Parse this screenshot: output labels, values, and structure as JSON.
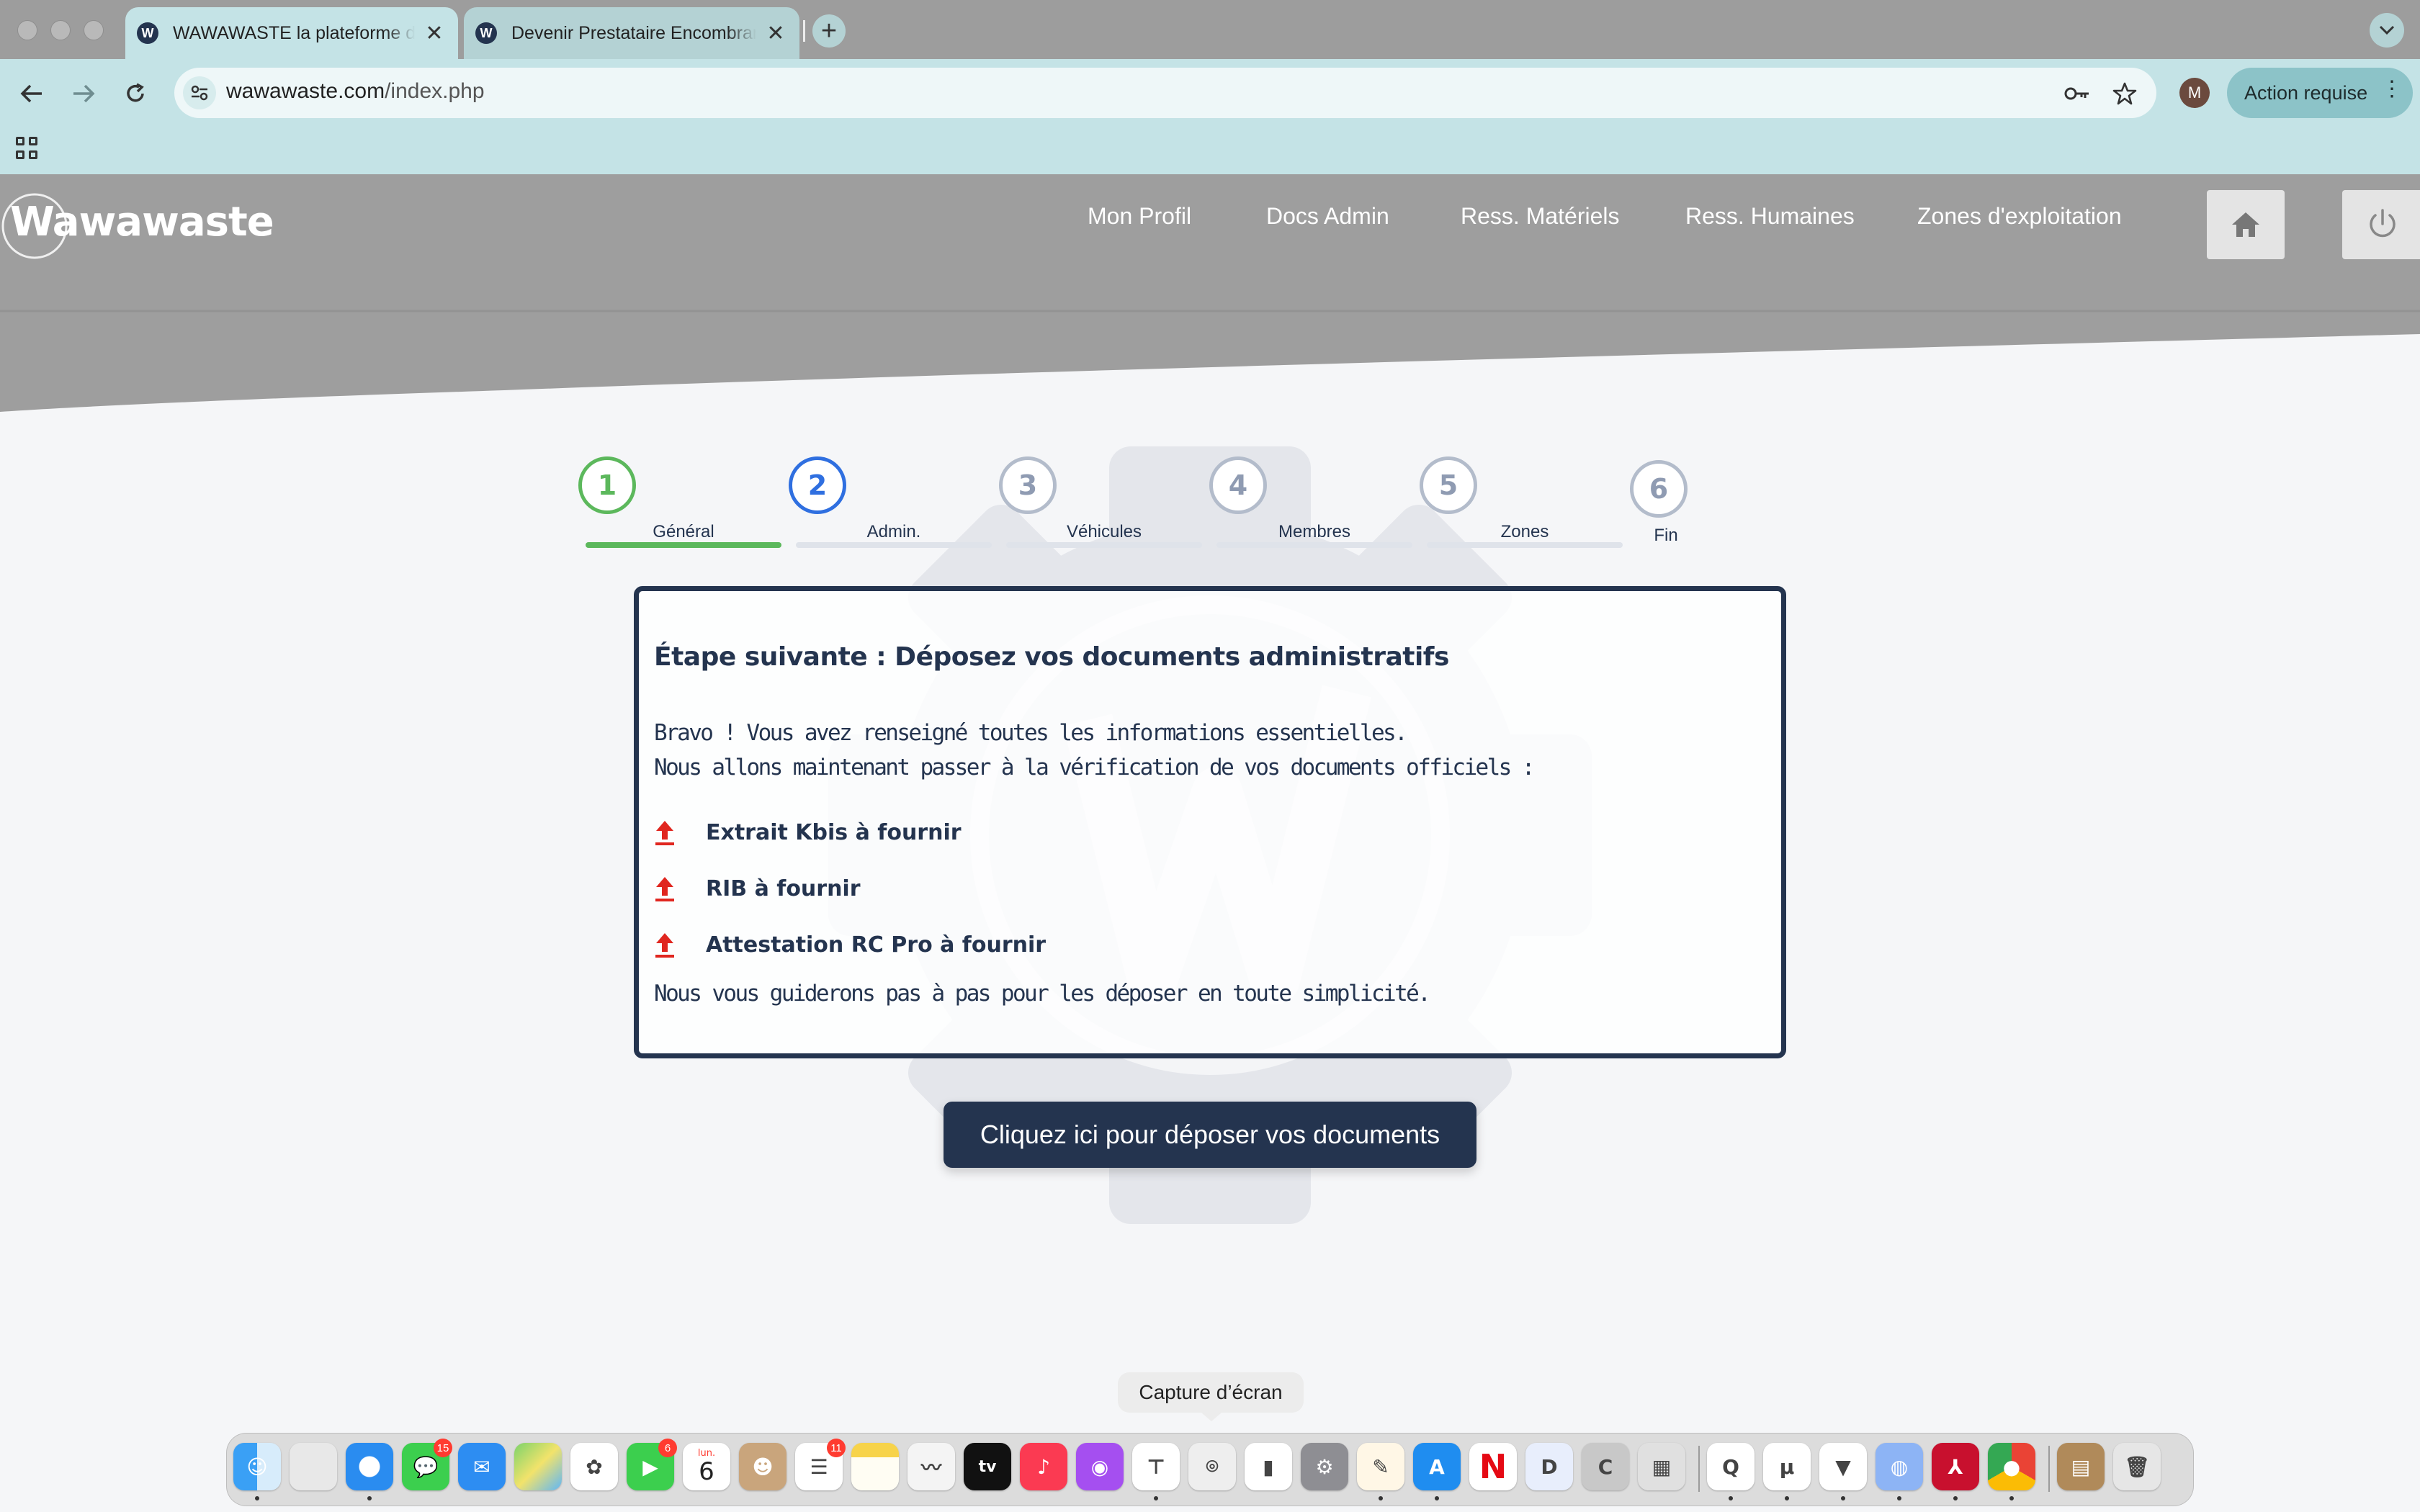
{
  "browser": {
    "tabs": [
      {
        "title": "WAWAWASTE la plateforme des encombrants",
        "active": true
      },
      {
        "title": "Devenir Prestataire Encombrants",
        "active": false
      }
    ],
    "url_domain": "wawawaste.com",
    "url_path": "/index.php",
    "profile_initial": "M",
    "action_label": "Action requise"
  },
  "site": {
    "logo_text": "Wawawaste",
    "nav": [
      "Mon Profil",
      "Docs Admin",
      "Ress. Matériels",
      "Ress. Humaines",
      "Zones d'exploitation"
    ]
  },
  "stepper": {
    "steps": [
      {
        "number": "1",
        "label": "Général",
        "state": "done"
      },
      {
        "number": "2",
        "label": "Admin.",
        "state": "current"
      },
      {
        "number": "3",
        "label": "Véhicules",
        "state": "todo"
      },
      {
        "number": "4",
        "label": "Membres",
        "state": "todo"
      },
      {
        "number": "5",
        "label": "Zones",
        "state": "todo"
      },
      {
        "number": "6",
        "label": "Fin",
        "state": "todo"
      }
    ],
    "colors": {
      "done": "#5cb85c",
      "current": "#2f6fe0",
      "todo": "#b3bccb"
    }
  },
  "card": {
    "title": "Étape suivante : Déposez vos documents administratifs",
    "intro_line1": "Bravo ! Vous avez renseigné toutes les informations essentielles.",
    "intro_line2": "Nous allons maintenant passer à la vérification de vos documents officiels :",
    "documents": [
      "Extrait Kbis à fournir",
      "RIB à fournir",
      "Attestation RC Pro à fournir"
    ],
    "outro": "Nous vous guiderons pas à pas pour les déposer en toute simplicité."
  },
  "cta_label": "Cliquez ici pour déposer vos documents",
  "dock": {
    "tooltip": "Capture d’écran",
    "calendar_month": "lun.",
    "calendar_day": "6",
    "badges": {
      "messages": "15",
      "facetime": "6",
      "reminders": "11"
    }
  },
  "colors": {
    "navy": "#24344f",
    "header_gray": "#9e9e9e",
    "upload_red": "#e0261f"
  }
}
